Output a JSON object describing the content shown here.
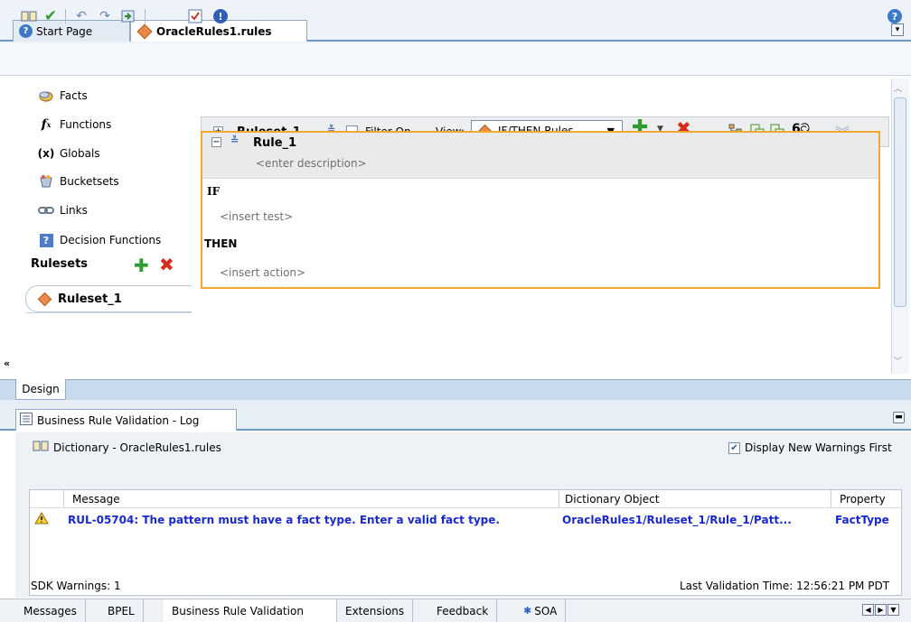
{
  "tabs": [
    {
      "label": "Start Page",
      "active": false
    },
    {
      "label": "OracleRules1.rules",
      "active": true
    }
  ],
  "nav": {
    "items": [
      {
        "label": "Facts",
        "icon": "facts-icon"
      },
      {
        "label": "Functions",
        "icon": "function-icon"
      },
      {
        "label": "Globals",
        "icon": "globals-icon"
      },
      {
        "label": "Bucketsets",
        "icon": "bucketsets-icon"
      },
      {
        "label": "Links",
        "icon": "links-icon"
      },
      {
        "label": "Decision Functions",
        "icon": "decision-function-icon"
      }
    ],
    "rulesets_label": "Rulesets",
    "ruleset_item": "Ruleset_1",
    "collapse_glyph": "«"
  },
  "editor": {
    "ruleset_name": "Ruleset_1",
    "filter_label": "Filter On",
    "view_label": "View:",
    "view_value": "IF/THEN Rules",
    "rule_name": "Rule_1",
    "rule_desc_placeholder": "<enter description>",
    "if_label": "IF",
    "insert_test": "<insert test>",
    "then_label": "THEN",
    "insert_action": "<insert action>"
  },
  "design_tab": "Design",
  "log": {
    "tab_label": "Business Rule Validation - Log",
    "dictionary_label": "Dictionary - OracleRules1.rules",
    "display_new_warnings": "Display New Warnings First",
    "display_new_warnings_checked": true,
    "columns": [
      "Message",
      "Dictionary Object",
      "Property"
    ],
    "rows": [
      {
        "message": "RUL-05704: The pattern must have a fact type.  Enter a valid fact type.",
        "object": "OracleRules1/Ruleset_1/Rule_1/Patt...",
        "property": "FactType"
      }
    ],
    "sdk_warnings": "SDK Warnings: 1",
    "last_validation": "Last Validation Time: 12:56:21 PM PDT"
  },
  "bottom_tabs": [
    {
      "label": "Messages",
      "active": false
    },
    {
      "label": "BPEL",
      "active": false
    },
    {
      "label": "Business Rule Validation",
      "active": true
    },
    {
      "label": "Extensions",
      "active": false
    },
    {
      "label": "Feedback",
      "active": false
    },
    {
      "label": "SOA",
      "active": false
    }
  ],
  "colors": {
    "accent": "#6e99c6",
    "rule_border": "#f0a830",
    "error_text": "#1a29c9"
  }
}
